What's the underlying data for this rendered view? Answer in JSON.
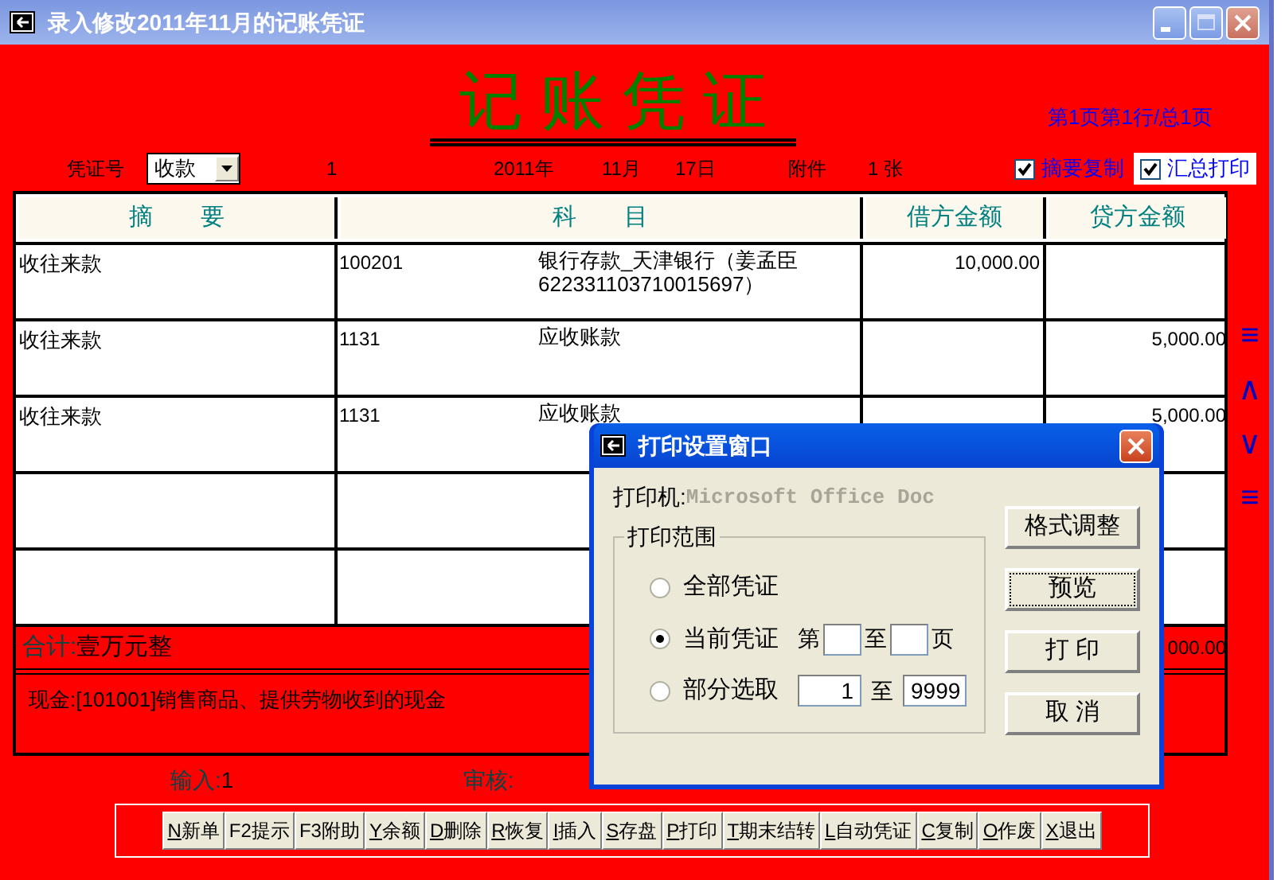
{
  "window": {
    "title": "录入修改2011年11月的记账凭证"
  },
  "voucher": {
    "heading": "记 账 凭 证",
    "page_info": "第1页第1行/总1页",
    "number_label": "凭证号",
    "type_value": "收款",
    "number": "1",
    "year": "2011年",
    "month": "11月",
    "day": "17日",
    "attachment_label": "附件",
    "attachment_count": "1 张"
  },
  "options": [
    {
      "label": "摘要复制",
      "checked": true,
      "highlighted": false
    },
    {
      "label": "汇总打印",
      "checked": true,
      "highlighted": true
    }
  ],
  "table": {
    "columns": [
      "摘　　要",
      "科　　目",
      "借方金额",
      "贷方金额"
    ],
    "rows": [
      {
        "summary": "收往来款",
        "account_code": "100201",
        "account_name": "银行存款_天津银行（姜孟臣 6223311037100156​97）",
        "debit": "10,000.00"
      },
      {
        "summary": "收往来款",
        "account_code": "1131",
        "account_name": "应收账款",
        "credit": "5,000.00"
      },
      {
        "summary": "收往来款",
        "account_code": "1131",
        "account_name": "应收账款",
        "credit": "5,000.00"
      },
      {},
      {}
    ]
  },
  "total": {
    "label": "合计:",
    "amount_words": "壹万元整",
    "credit": "000.00"
  },
  "note": "现金:[101001]销售商品、提供劳物收到的现金",
  "nav_buttons": [
    "≡",
    "∧",
    "∨",
    "≡"
  ],
  "footer": {
    "input_label": "输入:",
    "input_value": "1",
    "review_label": "审核:"
  },
  "toolbar": [
    {
      "hotkey": "N",
      "label": "新单"
    },
    {
      "label": "F2提示"
    },
    {
      "label": "F3附助"
    },
    {
      "hotkey": "Y",
      "label": "余额"
    },
    {
      "hotkey": "D",
      "label": "删除"
    },
    {
      "hotkey": "R",
      "label": "恢复"
    },
    {
      "hotkey": "I",
      "label": "插入"
    },
    {
      "hotkey": "S",
      "label": "存盘"
    },
    {
      "hotkey": "P",
      "label": "打印"
    },
    {
      "hotkey": "T",
      "label": "期末结转"
    },
    {
      "hotkey": "L",
      "label": "自动凭证"
    },
    {
      "hotkey": "C",
      "label": "复制"
    },
    {
      "hotkey": "O",
      "label": "作废"
    },
    {
      "hotkey": "X",
      "label": "退出"
    }
  ],
  "dialog": {
    "title": "打印设置窗口",
    "printer_label": "打印机:",
    "printer_name": "Microsoft Office Doc",
    "group_label": "打印范围",
    "range_options": [
      {
        "kind": "plain",
        "label": "全部凭证",
        "selected": false
      },
      {
        "kind": "pages",
        "label": "当前凭证",
        "selected": true,
        "from_label": "第",
        "to_label": "至",
        "end_label": "页"
      },
      {
        "kind": "range",
        "label": "部分选取",
        "selected": false,
        "from_value": "1",
        "to_label": "至",
        "to_value": "9999"
      }
    ],
    "buttons": [
      {
        "label": "格式调整",
        "focused": false
      },
      {
        "label": "预览",
        "focused": true
      },
      {
        "label": "打 印",
        "focused": false
      },
      {
        "label": "取 消",
        "focused": false
      }
    ]
  }
}
